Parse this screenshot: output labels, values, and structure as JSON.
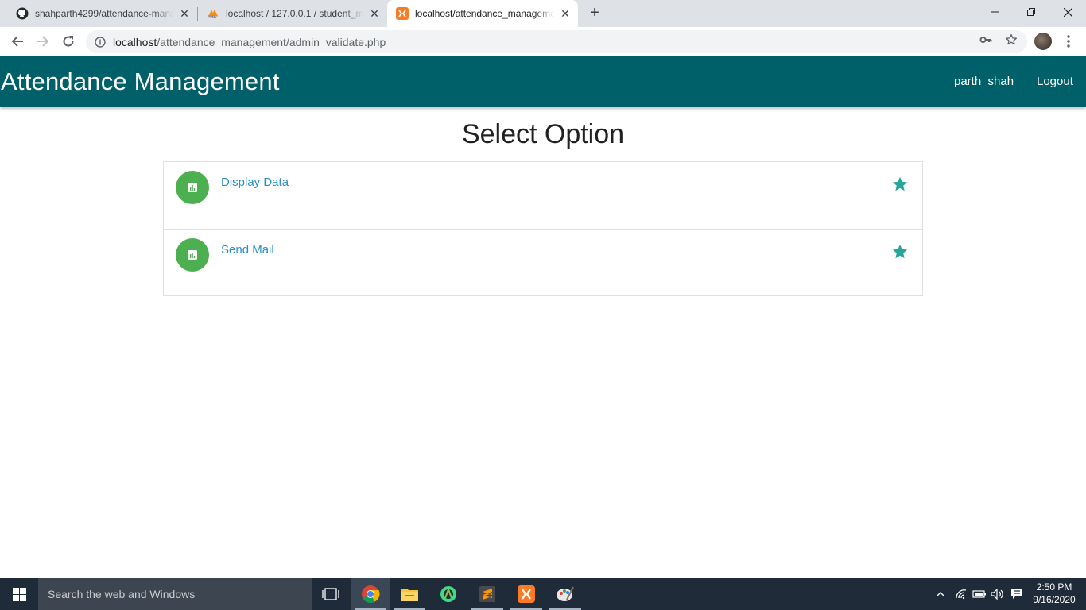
{
  "browser": {
    "tabs": [
      {
        "title": "shahparth4299/attendance-mana",
        "icon": "github-icon"
      },
      {
        "title": "localhost / 127.0.0.1 / student_ma",
        "icon": "phpmyadmin-icon"
      },
      {
        "title": "localhost/attendance_manageme",
        "icon": "xampp-icon",
        "active": true
      }
    ],
    "address": {
      "host": "localhost",
      "path": "/attendance_management/admin_validate.php"
    }
  },
  "app": {
    "brand": "Attendance Management",
    "nav": {
      "user": "parth_shah",
      "logout": "Logout"
    },
    "heading": "Select Option",
    "options": [
      {
        "label": "Display Data",
        "icon": "bar-chart-icon",
        "starred": true
      },
      {
        "label": "Send Mail",
        "icon": "bar-chart-icon",
        "starred": true
      }
    ],
    "colors": {
      "appbar": "#00606a",
      "option_circle": "#4caf50",
      "link": "#2b8ec2",
      "star": "#26a69a"
    }
  },
  "taskbar": {
    "search_placeholder": "Search the web and Windows",
    "time": "2:50 PM",
    "date": "9/16/2020"
  }
}
